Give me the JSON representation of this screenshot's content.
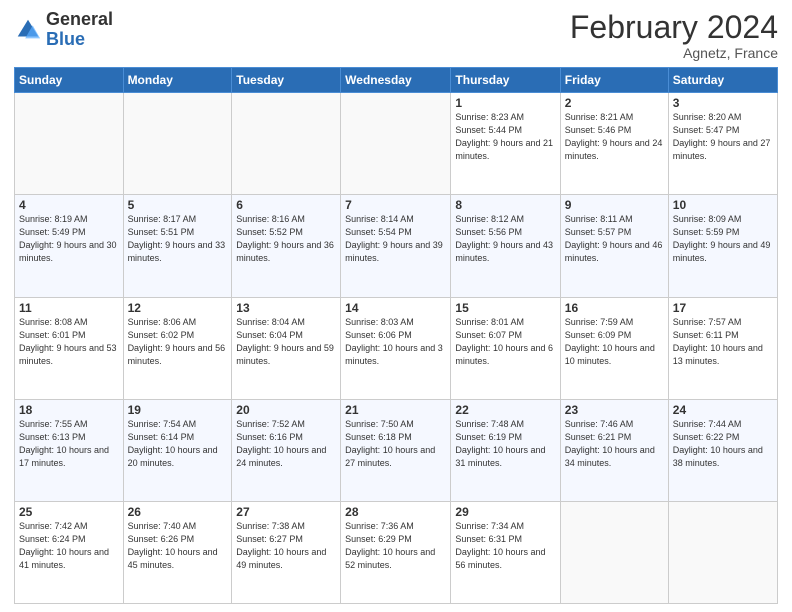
{
  "header": {
    "logo_general": "General",
    "logo_blue": "Blue",
    "month_title": "February 2024",
    "location": "Agnetz, France"
  },
  "days_of_week": [
    "Sunday",
    "Monday",
    "Tuesday",
    "Wednesday",
    "Thursday",
    "Friday",
    "Saturday"
  ],
  "weeks": [
    [
      {
        "num": "",
        "info": ""
      },
      {
        "num": "",
        "info": ""
      },
      {
        "num": "",
        "info": ""
      },
      {
        "num": "",
        "info": ""
      },
      {
        "num": "1",
        "info": "Sunrise: 8:23 AM\nSunset: 5:44 PM\nDaylight: 9 hours\nand 21 minutes."
      },
      {
        "num": "2",
        "info": "Sunrise: 8:21 AM\nSunset: 5:46 PM\nDaylight: 9 hours\nand 24 minutes."
      },
      {
        "num": "3",
        "info": "Sunrise: 8:20 AM\nSunset: 5:47 PM\nDaylight: 9 hours\nand 27 minutes."
      }
    ],
    [
      {
        "num": "4",
        "info": "Sunrise: 8:19 AM\nSunset: 5:49 PM\nDaylight: 9 hours\nand 30 minutes."
      },
      {
        "num": "5",
        "info": "Sunrise: 8:17 AM\nSunset: 5:51 PM\nDaylight: 9 hours\nand 33 minutes."
      },
      {
        "num": "6",
        "info": "Sunrise: 8:16 AM\nSunset: 5:52 PM\nDaylight: 9 hours\nand 36 minutes."
      },
      {
        "num": "7",
        "info": "Sunrise: 8:14 AM\nSunset: 5:54 PM\nDaylight: 9 hours\nand 39 minutes."
      },
      {
        "num": "8",
        "info": "Sunrise: 8:12 AM\nSunset: 5:56 PM\nDaylight: 9 hours\nand 43 minutes."
      },
      {
        "num": "9",
        "info": "Sunrise: 8:11 AM\nSunset: 5:57 PM\nDaylight: 9 hours\nand 46 minutes."
      },
      {
        "num": "10",
        "info": "Sunrise: 8:09 AM\nSunset: 5:59 PM\nDaylight: 9 hours\nand 49 minutes."
      }
    ],
    [
      {
        "num": "11",
        "info": "Sunrise: 8:08 AM\nSunset: 6:01 PM\nDaylight: 9 hours\nand 53 minutes."
      },
      {
        "num": "12",
        "info": "Sunrise: 8:06 AM\nSunset: 6:02 PM\nDaylight: 9 hours\nand 56 minutes."
      },
      {
        "num": "13",
        "info": "Sunrise: 8:04 AM\nSunset: 6:04 PM\nDaylight: 9 hours\nand 59 minutes."
      },
      {
        "num": "14",
        "info": "Sunrise: 8:03 AM\nSunset: 6:06 PM\nDaylight: 10 hours\nand 3 minutes."
      },
      {
        "num": "15",
        "info": "Sunrise: 8:01 AM\nSunset: 6:07 PM\nDaylight: 10 hours\nand 6 minutes."
      },
      {
        "num": "16",
        "info": "Sunrise: 7:59 AM\nSunset: 6:09 PM\nDaylight: 10 hours\nand 10 minutes."
      },
      {
        "num": "17",
        "info": "Sunrise: 7:57 AM\nSunset: 6:11 PM\nDaylight: 10 hours\nand 13 minutes."
      }
    ],
    [
      {
        "num": "18",
        "info": "Sunrise: 7:55 AM\nSunset: 6:13 PM\nDaylight: 10 hours\nand 17 minutes."
      },
      {
        "num": "19",
        "info": "Sunrise: 7:54 AM\nSunset: 6:14 PM\nDaylight: 10 hours\nand 20 minutes."
      },
      {
        "num": "20",
        "info": "Sunrise: 7:52 AM\nSunset: 6:16 PM\nDaylight: 10 hours\nand 24 minutes."
      },
      {
        "num": "21",
        "info": "Sunrise: 7:50 AM\nSunset: 6:18 PM\nDaylight: 10 hours\nand 27 minutes."
      },
      {
        "num": "22",
        "info": "Sunrise: 7:48 AM\nSunset: 6:19 PM\nDaylight: 10 hours\nand 31 minutes."
      },
      {
        "num": "23",
        "info": "Sunrise: 7:46 AM\nSunset: 6:21 PM\nDaylight: 10 hours\nand 34 minutes."
      },
      {
        "num": "24",
        "info": "Sunrise: 7:44 AM\nSunset: 6:22 PM\nDaylight: 10 hours\nand 38 minutes."
      }
    ],
    [
      {
        "num": "25",
        "info": "Sunrise: 7:42 AM\nSunset: 6:24 PM\nDaylight: 10 hours\nand 41 minutes."
      },
      {
        "num": "26",
        "info": "Sunrise: 7:40 AM\nSunset: 6:26 PM\nDaylight: 10 hours\nand 45 minutes."
      },
      {
        "num": "27",
        "info": "Sunrise: 7:38 AM\nSunset: 6:27 PM\nDaylight: 10 hours\nand 49 minutes."
      },
      {
        "num": "28",
        "info": "Sunrise: 7:36 AM\nSunset: 6:29 PM\nDaylight: 10 hours\nand 52 minutes."
      },
      {
        "num": "29",
        "info": "Sunrise: 7:34 AM\nSunset: 6:31 PM\nDaylight: 10 hours\nand 56 minutes."
      },
      {
        "num": "",
        "info": ""
      },
      {
        "num": "",
        "info": ""
      }
    ]
  ]
}
